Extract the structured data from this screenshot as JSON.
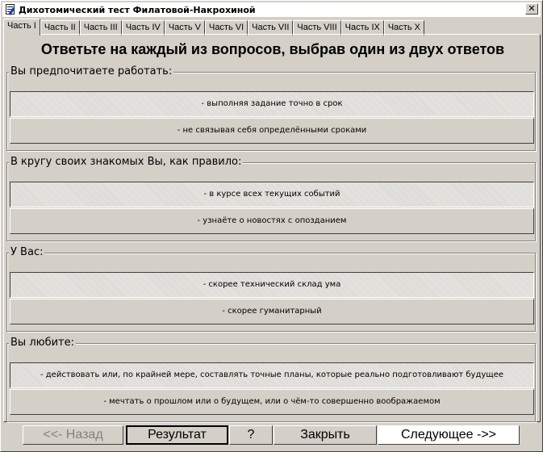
{
  "window": {
    "title": "Дихотомический тест Филатовой-Накрохиной",
    "close_glyph": "✕"
  },
  "tabs": [
    {
      "label": "Часть I",
      "active": true
    },
    {
      "label": "Часть II"
    },
    {
      "label": "Часть III"
    },
    {
      "label": "Часть IV"
    },
    {
      "label": "Часть V"
    },
    {
      "label": "Часть VI"
    },
    {
      "label": "Часть VII"
    },
    {
      "label": "Часть VIII"
    },
    {
      "label": "Часть IX"
    },
    {
      "label": "Часть X"
    }
  ],
  "heading": "Ответьте на каждый из вопросов, выбрав один из двух ответов",
  "questions": [
    {
      "label": "Вы предпочитаете работать:",
      "a": "- выполняя задание точно в срок",
      "b": "- не связывая себя определёнными сроками"
    },
    {
      "label": "В кругу своих знакомых Вы, как правило:",
      "a": "- в курсе всех текущих событий",
      "b": "- узнаёте о новостях с опозданием"
    },
    {
      "label": "У Вас:",
      "a": "- скорее технический склад ума",
      "b": "- скорее гуманитарный"
    },
    {
      "label": "Вы любите:",
      "a": "- действовать или, по крайней мере, составлять точные планы, которые реально подготовливают будущее",
      "b": "- мечтать о прошлом или о будущем, или о чём-то совершенно воображаемом"
    }
  ],
  "buttons": {
    "back": "<<- Назад",
    "result": "Результат",
    "help": "?",
    "close": "Закрыть",
    "next": "Следующее ->>"
  },
  "icons": {
    "app": "test-sheet-icon",
    "close": "close-icon"
  }
}
